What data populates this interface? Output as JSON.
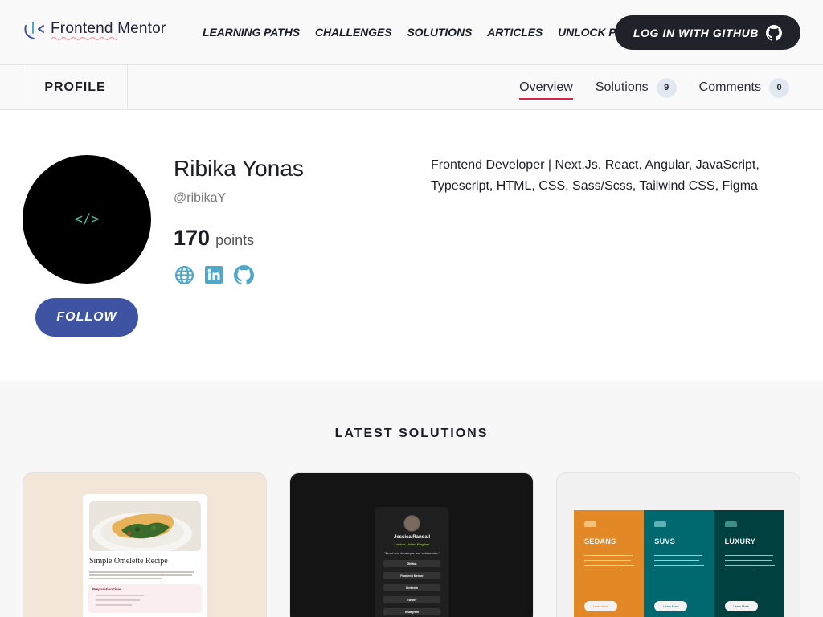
{
  "header": {
    "logo_text": "Frontend Mentor",
    "nav": [
      "LEARNING PATHS",
      "CHALLENGES",
      "SOLUTIONS",
      "ARTICLES",
      "UNLOCK PRO"
    ],
    "login_label": "LOG IN WITH GITHUB"
  },
  "profile_bar": {
    "profile_label": "PROFILE",
    "tabs": [
      {
        "label": "Overview",
        "active": true
      },
      {
        "label": "Solutions",
        "count": "9"
      },
      {
        "label": "Comments",
        "count": "0"
      }
    ]
  },
  "profile": {
    "avatar_glyph": "</>",
    "name": "Ribika Yonas",
    "handle": "@ribikaY",
    "points_value": "170",
    "points_label": "points",
    "follow_label": "FOLLOW",
    "bio": "Frontend Developer | Next.Js, React, Angular, JavaScript, Typescript, HTML, CSS, Sass/Scss, Tailwind CSS, Figma",
    "socials": [
      "globe-icon",
      "linkedin-icon",
      "github-icon"
    ]
  },
  "latest": {
    "title": "LATEST SOLUTIONS",
    "cards": [
      {
        "preview_title": "Simple Omelette Recipe",
        "preview_section": "Preparation time"
      },
      {
        "preview_name": "Jessica Randall",
        "preview_location": "London, United Kingdom",
        "preview_bio": "\"Front-end developer and avid reader.\"",
        "preview_links": [
          "GitHub",
          "Frontend Mentor",
          "LinkedIn",
          "Twitter",
          "Instagram"
        ]
      },
      {
        "preview_columns": [
          "SEDANS",
          "SUVS",
          "LUXURY"
        ],
        "preview_button": "Learn More"
      }
    ]
  },
  "colors": {
    "accent_red": "#d6294a",
    "follow_blue": "#3e54a3",
    "social_teal": "#4fa8c9",
    "sedans": "#e38826",
    "suvs": "#006970",
    "luxury": "#004140"
  }
}
